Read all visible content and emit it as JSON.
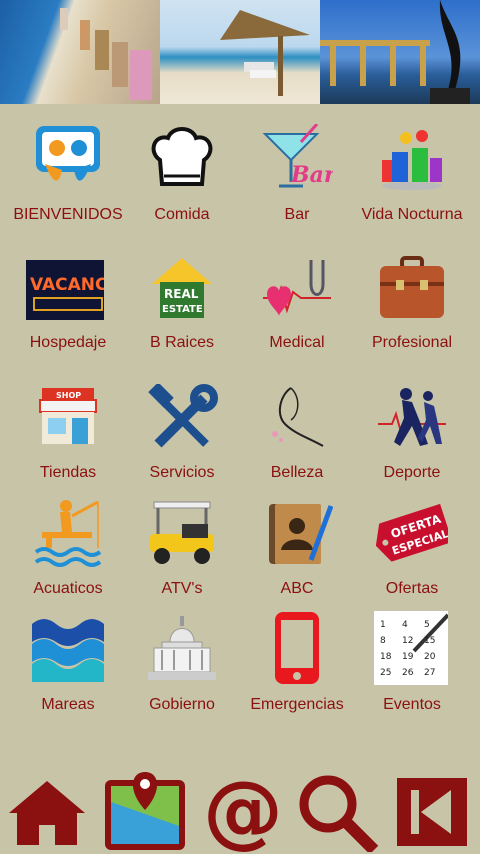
{
  "banner": [
    "beach-city-photo",
    "beach-palapa-photo",
    "monument-photo"
  ],
  "colors": {
    "background": "#c8c4a8",
    "label": "#8b1010",
    "nav": "#8b1010"
  },
  "menu": [
    {
      "label": "BIENVENIDOS",
      "icon": "slideshare-icon"
    },
    {
      "label": "Comida",
      "icon": "chef-hat-icon"
    },
    {
      "label": "Bar",
      "icon": "cocktail-bar-icon"
    },
    {
      "label": "Vida Nocturna",
      "icon": "drinks-icon"
    },
    {
      "label": "Hospedaje",
      "icon": "vacancy-sign-icon"
    },
    {
      "label": "B Raices",
      "icon": "real-estate-icon"
    },
    {
      "label": "Medical",
      "icon": "stethoscope-icon"
    },
    {
      "label": "Profesional",
      "icon": "briefcase-icon"
    },
    {
      "label": "Tiendas",
      "icon": "shop-icon"
    },
    {
      "label": "Servicios",
      "icon": "tools-icon"
    },
    {
      "label": "Belleza",
      "icon": "beauty-icon"
    },
    {
      "label": "Deporte",
      "icon": "runners-icon"
    },
    {
      "label": "Acuaticos",
      "icon": "fishing-icon"
    },
    {
      "label": "ATV's",
      "icon": "golf-cart-icon"
    },
    {
      "label": "ABC",
      "icon": "address-book-icon"
    },
    {
      "label": "Ofertas",
      "icon": "oferta-especial-icon"
    },
    {
      "label": "Mareas",
      "icon": "waves-icon"
    },
    {
      "label": "Gobierno",
      "icon": "capitol-icon"
    },
    {
      "label": "Emergencias",
      "icon": "phone-icon"
    },
    {
      "label": "Eventos",
      "icon": "calendar-icon"
    }
  ],
  "badges": {
    "vacancy": "VACANCY",
    "real": "REAL",
    "estate": "ESTATE",
    "shop": "SHOP",
    "oferta": "OFERTA",
    "especial": "ESPECIAL",
    "bar": "Bar"
  },
  "calendar": [
    "1",
    "4",
    "5",
    "8",
    "12",
    "15",
    "18",
    "19",
    "20",
    "25",
    "26",
    "27"
  ],
  "nav": [
    "home-icon",
    "map-pin-icon",
    "at-icon",
    "search-icon",
    "back-icon"
  ]
}
